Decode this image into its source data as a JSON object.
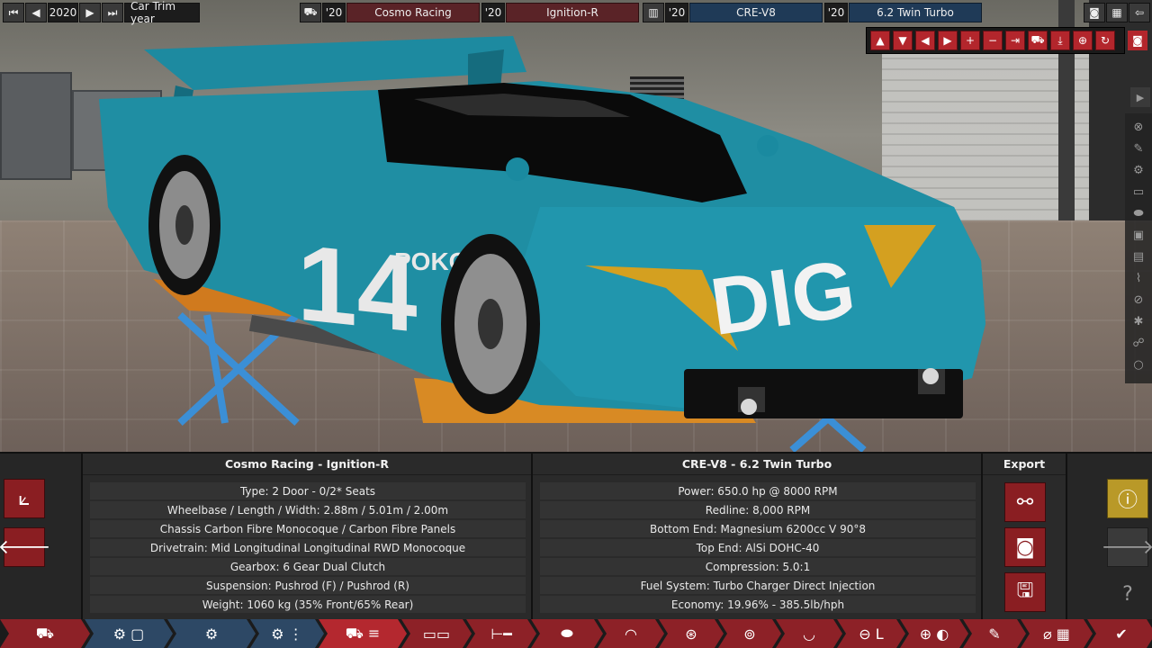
{
  "topbar": {
    "year": "2020",
    "car_trim_year_label": "Car Trim year",
    "model_year": "'20",
    "model_name": "Cosmo Racing",
    "trim_year": "'20",
    "trim_name": "Ignition-R",
    "family_year": "'20",
    "family_name": "CRE-V8",
    "variant_year": "'20",
    "variant_name": "6.2 Twin Turbo"
  },
  "body_panel": {
    "title": "Cosmo Racing - Ignition-R",
    "rows": [
      "Type: 2 Door - 0/2* Seats",
      "Wheelbase / Length / Width: 2.88m / 5.01m / 2.00m",
      "Chassis Carbon Fibre Monocoque / Carbon Fibre Panels",
      "Drivetrain: Mid Longitudinal Longitudinal RWD Monocoque",
      "Gearbox: 6 Gear Dual Clutch",
      "Suspension: Pushrod (F) / Pushrod (R)",
      "Weight: 1060 kg (35% Front/65% Rear)"
    ]
  },
  "engine_panel": {
    "title": "CRE-V8 - 6.2 Twin Turbo",
    "rows": [
      "Power: 650.0 hp @ 8000 RPM",
      "Redline:  8,000 RPM",
      "Bottom End: Magnesium 6200cc V 90°8",
      "Top End: AlSi DOHC-40",
      "Compression: 5.0:1",
      "Fuel System: Turbo Charger Direct Injection",
      "Economy: 19.96% - 385.5lb/hph"
    ]
  },
  "export_panel": {
    "title": "Export"
  },
  "car_livery": {
    "number": "14",
    "sponsor_side": "POKO",
    "sponsor_hood": "DIG",
    "body_color": "#1f8ea3",
    "accent_color": "#d4a020"
  },
  "colors": {
    "red": "#8d2127",
    "blue": "#2d4865",
    "gold": "#b99928"
  }
}
